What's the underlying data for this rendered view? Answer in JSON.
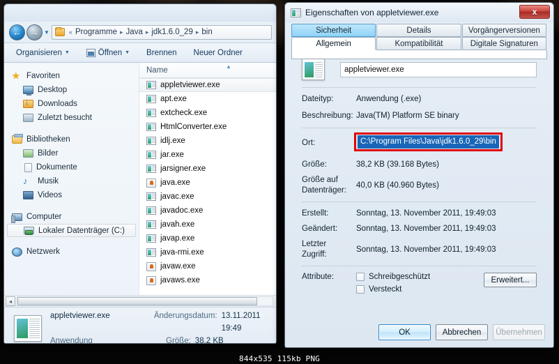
{
  "caption": "844x535 115kb PNG",
  "explorer": {
    "nav": {
      "back_icon": "arrow-left-icon",
      "forward_icon": "arrow-right-icon",
      "history_icon": "chevron-down-icon",
      "back_glyph": "←",
      "forward_glyph": "→",
      "history_glyph": "▼"
    },
    "address": {
      "folder_icon": "folder-icon",
      "overflow": "«",
      "crumbs": [
        "Programme",
        "Java",
        "jdk1.6.0_29",
        "bin"
      ],
      "separator": "▸"
    },
    "toolbar": {
      "organize": "Organisieren",
      "open": "Öffnen",
      "burn": "Brennen",
      "new_folder": "Neuer Ordner",
      "caret": "▼"
    },
    "sidebar": {
      "groups": [
        {
          "header": {
            "label": "Favoriten",
            "icon": "star-icon"
          },
          "items": [
            {
              "label": "Desktop",
              "icon": "desktop-icon"
            },
            {
              "label": "Downloads",
              "icon": "downloads-icon"
            },
            {
              "label": "Zuletzt besucht",
              "icon": "recent-places-icon"
            }
          ]
        },
        {
          "header": {
            "label": "Bibliotheken",
            "icon": "libraries-icon"
          },
          "items": [
            {
              "label": "Bilder",
              "icon": "pictures-icon"
            },
            {
              "label": "Dokumente",
              "icon": "documents-icon"
            },
            {
              "label": "Musik",
              "icon": "music-icon"
            },
            {
              "label": "Videos",
              "icon": "videos-icon"
            }
          ]
        },
        {
          "header": {
            "label": "Computer",
            "icon": "computer-icon"
          },
          "items": [
            {
              "label": "Lokaler Datenträger (C:)",
              "icon": "hard-drive-icon",
              "selected": true
            }
          ]
        },
        {
          "header": {
            "label": "Netzwerk",
            "icon": "network-icon"
          },
          "items": []
        }
      ]
    },
    "filelist": {
      "column_header": "Name",
      "sort_arrow": "▲",
      "rows": [
        {
          "name": "appletviewer.exe",
          "icon": "exe-icon",
          "selected": true
        },
        {
          "name": "apt.exe",
          "icon": "exe-icon"
        },
        {
          "name": "extcheck.exe",
          "icon": "exe-icon"
        },
        {
          "name": "HtmlConverter.exe",
          "icon": "exe-icon"
        },
        {
          "name": "idlj.exe",
          "icon": "exe-icon"
        },
        {
          "name": "jar.exe",
          "icon": "exe-icon"
        },
        {
          "name": "jarsigner.exe",
          "icon": "exe-icon"
        },
        {
          "name": "java.exe",
          "icon": "java-icon"
        },
        {
          "name": "javac.exe",
          "icon": "exe-icon"
        },
        {
          "name": "javadoc.exe",
          "icon": "exe-icon"
        },
        {
          "name": "javah.exe",
          "icon": "exe-icon"
        },
        {
          "name": "javap.exe",
          "icon": "exe-icon"
        },
        {
          "name": "java-rmi.exe",
          "icon": "exe-icon"
        },
        {
          "name": "javaw.exe",
          "icon": "java-icon"
        },
        {
          "name": "javaws.exe",
          "icon": "java-icon"
        }
      ],
      "hscroll": {
        "left_glyph": "◂"
      }
    },
    "details_pane": {
      "icon": "application-icon",
      "name": "appletviewer.exe",
      "type": "Anwendung",
      "modified_key": "Änderungsdatum:",
      "modified_value": "13.11.2011 19:49",
      "size_key": "Größe:",
      "size_value": "38,2 KB"
    }
  },
  "dialog": {
    "title": "Eigenschaften von appletviewer.exe",
    "title_icon": "application-icon",
    "close_label": "x",
    "tabs_row1": [
      {
        "label": "Sicherheit",
        "state": "hover"
      },
      {
        "label": "Details",
        "state": "normal"
      },
      {
        "label": "Vorgängerversionen",
        "state": "normal"
      }
    ],
    "tabs_row2": [
      {
        "label": "Allgemein",
        "state": "active"
      },
      {
        "label": "Kompatibilität",
        "state": "normal"
      },
      {
        "label": "Digitale Signaturen",
        "state": "normal"
      }
    ],
    "file_icon": "application-icon",
    "file_name": "appletviewer.exe",
    "fields": [
      {
        "key": "Dateityp:",
        "value": "Anwendung (.exe)"
      },
      {
        "key": "Beschreibung:",
        "value": "Java(TM) Platform SE binary"
      }
    ],
    "location": {
      "key": "Ort:",
      "value": "C:\\Program Files\\Java\\jdk1.6.0_29\\bin",
      "selected": true,
      "highlight_color": "#e00000",
      "selection_color": "#1966b8"
    },
    "size_fields": [
      {
        "key": "Größe:",
        "value": "38,2 KB (39.168 Bytes)"
      },
      {
        "key": "Größe auf Datenträger:",
        "value": "40,0 KB (40.960 Bytes)"
      }
    ],
    "date_fields": [
      {
        "key": "Erstellt:",
        "value": "Sonntag, 13. November 2011, 19:49:03"
      },
      {
        "key": "Geändert:",
        "value": "Sonntag, 13. November 2011, 19:49:03"
      },
      {
        "key": "Letzter Zugriff:",
        "value": "Sonntag, 13. November 2011, 19:49:03"
      }
    ],
    "attributes": {
      "key": "Attribute:",
      "checkboxes": [
        {
          "label": "Schreibgeschützt",
          "checked": false
        },
        {
          "label": "Versteckt",
          "checked": false
        }
      ],
      "advanced_button": "Erweitert..."
    },
    "buttons": [
      {
        "label": "OK",
        "style": "default"
      },
      {
        "label": "Abbrechen",
        "style": "normal"
      },
      {
        "label": "Übernehmen",
        "style": "disabled"
      }
    ]
  }
}
